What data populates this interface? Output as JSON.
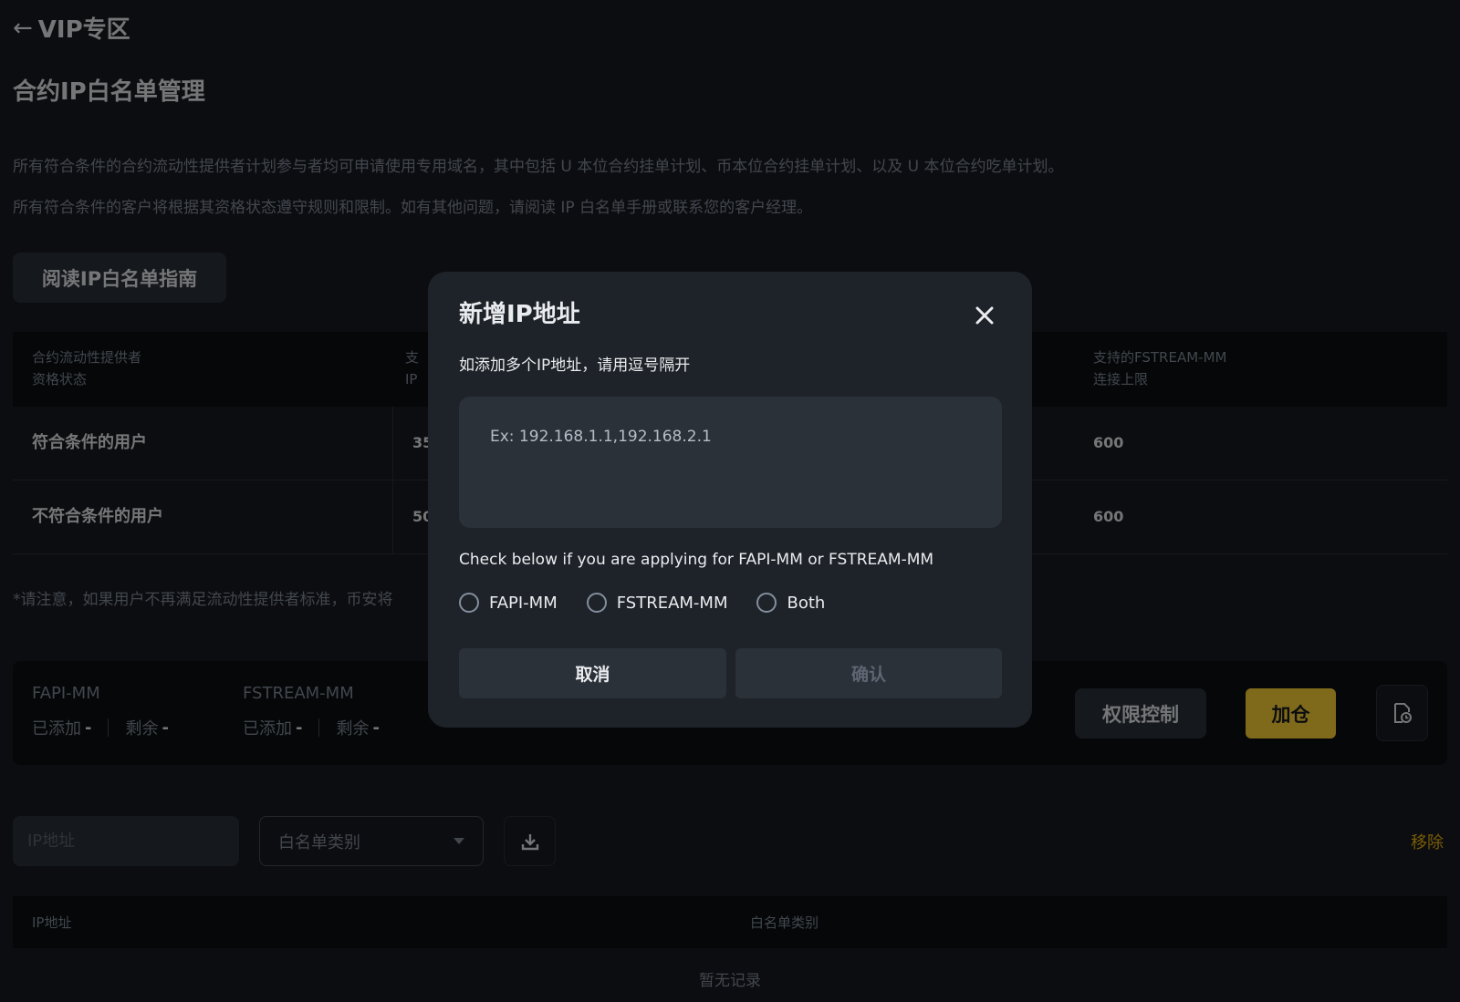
{
  "header": {
    "back_title": "VIP专区",
    "page_title": "合约IP白名单管理",
    "desc_1": "所有符合条件的合约流动性提供者计划参与者均可申请使用专用域名，其中包括 U 本位合约挂单计划、币本位合约挂单计划、以及 U 本位合约吃单计划。",
    "desc_2": "所有符合条件的客户将根据其资格状态遵守规则和限制。如有其他问题，请阅读 IP 白名单手册或联系您的客户经理。",
    "guide_button": "阅读IP白名单指南"
  },
  "info_table": {
    "headers": {
      "col1_line1": "合约流动性提供者",
      "col1_line2": "资格状态",
      "col2_line1": "支",
      "col2_line2": "IP",
      "col4_line1": "支持的FSTREAM-MM",
      "col4_line2": "连接上限"
    },
    "rows": [
      {
        "status": "符合条件的用户",
        "col2": "35",
        "col4": "600"
      },
      {
        "status": "不符合条件的用户",
        "col2": "50",
        "col4": "600"
      }
    ]
  },
  "note": "*请注意，如果用户不再满足流动性提供者标准，币安将",
  "quota": {
    "fapi_label": "FAPI-MM",
    "fstream_label": "FSTREAM-MM",
    "added_label": "已添加",
    "remaining_label": "剩余",
    "fapi_added": "-",
    "fapi_remaining": "-",
    "fstream_added": "-",
    "fstream_remaining": "-",
    "permission_button": "权限控制",
    "add_button": "加仓"
  },
  "filters": {
    "ip_placeholder": "IP地址",
    "type_select": "白名单类别",
    "remove_link": "移除"
  },
  "list": {
    "col_ip": "IP地址",
    "col_type": "白名单类别",
    "empty": "暂无记录"
  },
  "modal": {
    "title": "新增IP地址",
    "hint": "如添加多个IP地址，请用逗号隔开",
    "textarea_placeholder": "Ex: 192.168.1.1,192.168.2.1",
    "apply_hint": "Check below if you are applying for FAPI-MM or FSTREAM-MM",
    "options": [
      "FAPI-MM",
      "FSTREAM-MM",
      "Both"
    ],
    "cancel": "取消",
    "confirm": "确认"
  },
  "colors": {
    "background": "#181a20",
    "panel": "#0b0e11",
    "modal": "#1e2329",
    "accent": "#fcd535",
    "link": "#f0b90b"
  }
}
